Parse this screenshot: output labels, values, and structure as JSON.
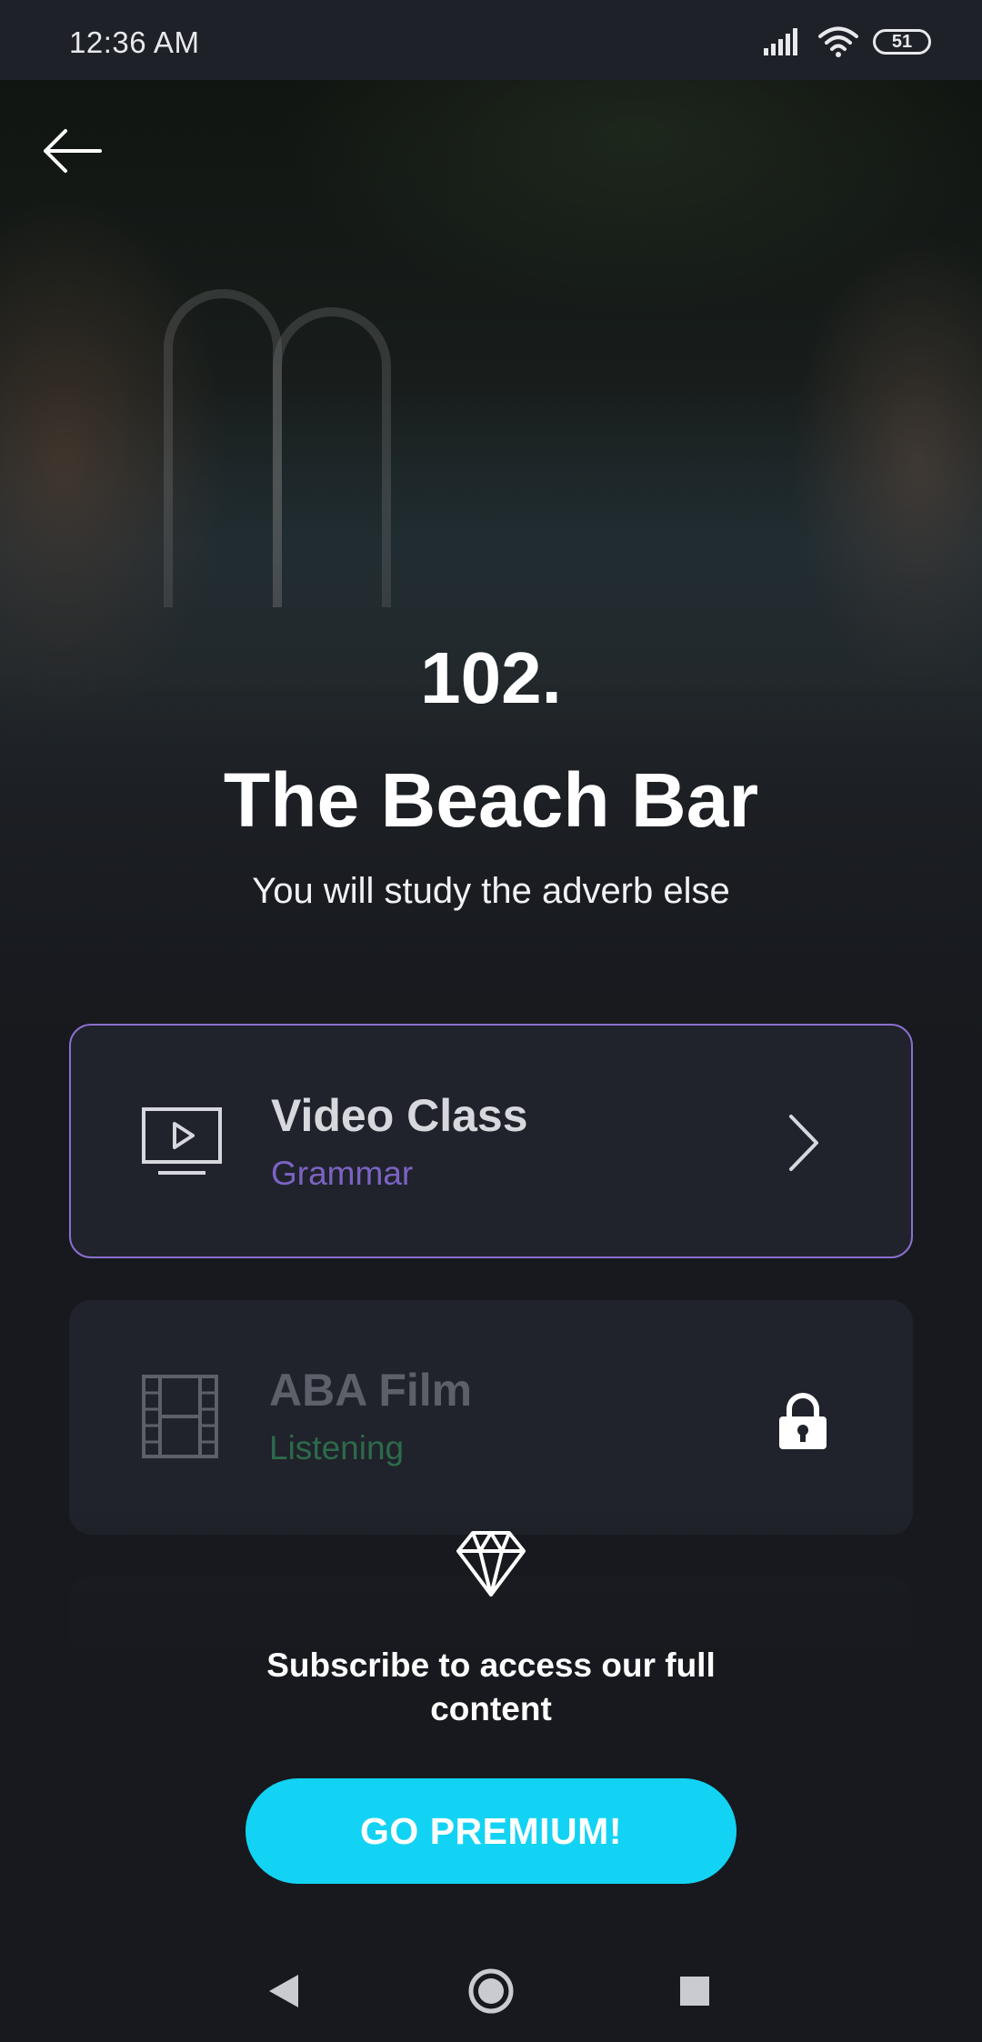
{
  "status_bar": {
    "time": "12:36 AM",
    "battery": "51"
  },
  "lesson": {
    "number": "102.",
    "title": "The Beach Bar",
    "subtitle": "You will study the adverb else"
  },
  "cards": [
    {
      "title": "Video Class",
      "subtitle": "Grammar",
      "icon": "monitor-play-icon",
      "locked": false
    },
    {
      "title": "ABA Film",
      "subtitle": "Listening",
      "icon": "film-strip-icon",
      "locked": true
    }
  ],
  "premium": {
    "message": "Subscribe to access our full content",
    "button_label": "GO PREMIUM!"
  },
  "colors": {
    "accent_purple": "#8a6fd0",
    "accent_cyan": "#12d3f3",
    "listening_green": "#2d6a4a",
    "background": "#17191e"
  }
}
